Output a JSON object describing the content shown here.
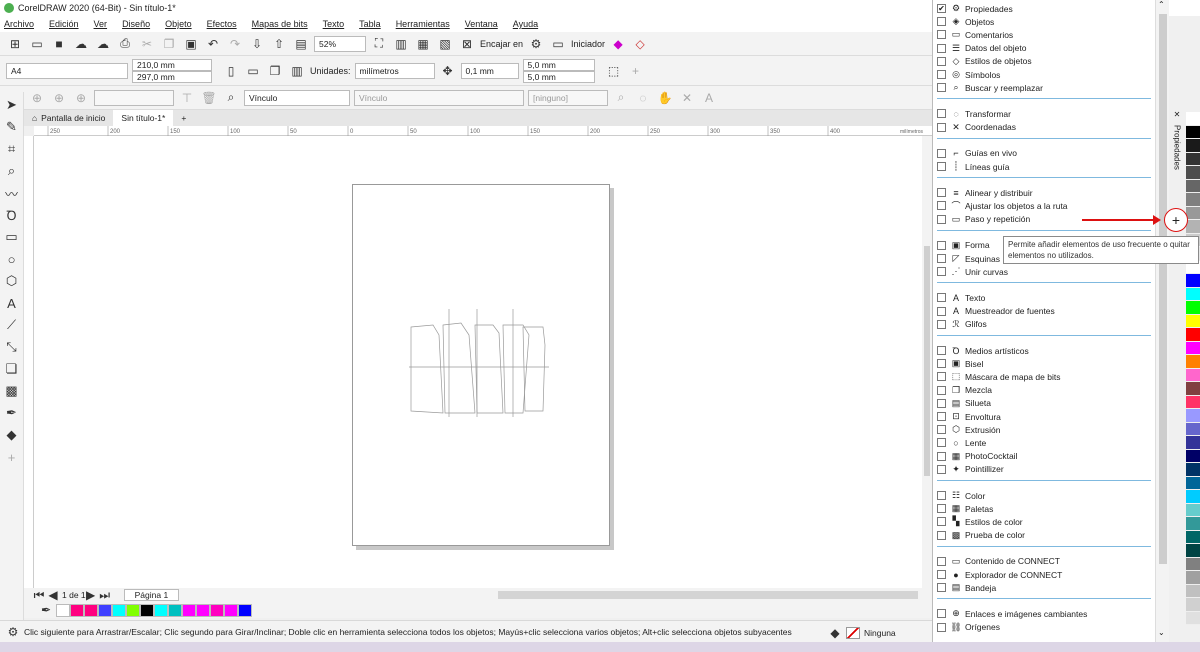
{
  "window": {
    "title": "CorelDRAW 2020 (64-Bit) - Sin título-1*"
  },
  "menu": [
    "Archivo",
    "Edición",
    "Ver",
    "Diseño",
    "Objeto",
    "Efectos",
    "Mapas de bits",
    "Texto",
    "Tabla",
    "Herramientas",
    "Ventana",
    "Ayuda"
  ],
  "toolbar1": {
    "zoom": "52%",
    "snap_label": "Encajar en",
    "launcher_label": "Iniciador"
  },
  "toolbar2": {
    "page_size": "A4",
    "width": "210,0 mm",
    "height": "297,0 mm",
    "units_label": "Unidades:",
    "units": "milímetros",
    "nudge": "0,1 mm",
    "dup_x": "5,0 mm",
    "dup_y": "5,0 mm"
  },
  "toolbar3": {
    "link1": "Vínculo",
    "link2": "Vínculo",
    "none": "[ninguno]"
  },
  "tabs": {
    "home": "Pantalla de inicio",
    "doc": "Sin título-1*"
  },
  "ruler": {
    "ticks": [
      "250",
      "200",
      "150",
      "100",
      "50",
      "0",
      "50",
      "100",
      "150",
      "200",
      "250",
      "300",
      "350",
      "400"
    ],
    "unit": "milímetros"
  },
  "pagebar": {
    "page_of": "1 de 1",
    "page_tab": "Página 1"
  },
  "status": {
    "hint": "Clic siguiente para Arrastrar/Escalar; Clic segundo para Girar/Inclinar; Doble clic en herramienta selecciona todos los objetos; Mayús+clic selecciona varios objetos; Alt+clic selecciona objetos subyacentes",
    "fill": "Ninguna"
  },
  "panel": {
    "side_tab": "Propiedades",
    "tooltip": "Permite añadir elementos de uso frecuente o quitar elementos no utilizados.",
    "groups": [
      {
        "items": [
          {
            "label": "Propiedades",
            "checked": true,
            "icon": "⚙"
          },
          {
            "label": "Objetos",
            "checked": false,
            "icon": "◈"
          },
          {
            "label": "Comentarios",
            "checked": false,
            "icon": "▭"
          },
          {
            "label": "Datos del objeto",
            "checked": false,
            "icon": "☰"
          },
          {
            "label": "Estilos de objetos",
            "checked": false,
            "icon": "◇"
          },
          {
            "label": "Símbolos",
            "checked": false,
            "icon": "◎"
          },
          {
            "label": "Buscar y reemplazar",
            "checked": false,
            "icon": "⌕"
          }
        ]
      },
      {
        "items": [
          {
            "label": "Transformar",
            "checked": false,
            "icon": "◌"
          },
          {
            "label": "Coordenadas",
            "checked": false,
            "icon": "✕"
          }
        ]
      },
      {
        "items": [
          {
            "label": "Guías en vivo",
            "checked": false,
            "icon": "⌐"
          },
          {
            "label": "Líneas guía",
            "checked": false,
            "icon": "┊"
          }
        ]
      },
      {
        "items": [
          {
            "label": "Alinear y distribuir",
            "checked": false,
            "icon": "≡"
          },
          {
            "label": "Ajustar los objetos a la ruta",
            "checked": false,
            "icon": "⌒"
          },
          {
            "label": "Paso y repetición",
            "checked": false,
            "icon": "▭"
          }
        ]
      },
      {
        "items": [
          {
            "label": "Forma",
            "checked": false,
            "icon": "▣"
          },
          {
            "label": "Esquinas",
            "checked": false,
            "icon": "◸"
          },
          {
            "label": "Unir curvas",
            "checked": false,
            "icon": "⋰"
          }
        ]
      },
      {
        "items": [
          {
            "label": "Texto",
            "checked": false,
            "icon": "A"
          },
          {
            "label": "Muestreador de fuentes",
            "checked": false,
            "icon": "A"
          },
          {
            "label": "Glifos",
            "checked": false,
            "icon": "ℛ"
          }
        ]
      },
      {
        "items": [
          {
            "label": "Medios artísticos",
            "checked": false,
            "icon": "Ꝺ"
          },
          {
            "label": "Bisel",
            "checked": false,
            "icon": "▣"
          },
          {
            "label": "Máscara de mapa de bits",
            "checked": false,
            "icon": "⬚"
          },
          {
            "label": "Mezcla",
            "checked": false,
            "icon": "❐"
          },
          {
            "label": "Silueta",
            "checked": false,
            "icon": "▤"
          },
          {
            "label": "Envoltura",
            "checked": false,
            "icon": "⊡"
          },
          {
            "label": "Extrusión",
            "checked": false,
            "icon": "⬡"
          },
          {
            "label": "Lente",
            "checked": false,
            "icon": "○"
          },
          {
            "label": "PhotoCocktail",
            "checked": false,
            "icon": "▦"
          },
          {
            "label": "Pointillizer",
            "checked": false,
            "icon": "✦"
          }
        ]
      },
      {
        "items": [
          {
            "label": "Color",
            "checked": false,
            "icon": "☷"
          },
          {
            "label": "Paletas",
            "checked": false,
            "icon": "▦"
          },
          {
            "label": "Estilos de color",
            "checked": false,
            "icon": "▚"
          },
          {
            "label": "Prueba de color",
            "checked": false,
            "icon": "▩"
          }
        ]
      },
      {
        "items": [
          {
            "label": "Contenido de CONNECT",
            "checked": false,
            "icon": "▭"
          },
          {
            "label": "Explorador de CONNECT",
            "checked": false,
            "icon": "●"
          },
          {
            "label": "Bandeja",
            "checked": false,
            "icon": "▤"
          }
        ]
      },
      {
        "items": [
          {
            "label": "Enlaces e imágenes cambiantes",
            "checked": false,
            "icon": "⊕"
          },
          {
            "label": "Orígenes",
            "checked": false,
            "icon": "⛓"
          }
        ]
      }
    ]
  },
  "doc_palette": [
    "#ff0080",
    "#ff0080",
    "#4040ff",
    "#00ffff",
    "#80ff00",
    "#000000",
    "#00ffff",
    "#00c0c0",
    "#ff00ff",
    "#ff00ff",
    "#ff00c0",
    "#ff00ff",
    "#0000ff"
  ],
  "right_palette": [
    "#ffffff",
    "#000000",
    "#1a1a1a",
    "#333333",
    "#4d4d4d",
    "#666666",
    "#808080",
    "#999999",
    "#b3b3b3",
    "#cccccc",
    "#e6e6e6",
    "#ffffff",
    "#0000ff",
    "#00ffff",
    "#00ff00",
    "#ffff00",
    "#ff0000",
    "#ff00ff",
    "#ff8000",
    "#ff66cc",
    "#804040",
    "#ff3366",
    "#9999ff",
    "#6666cc",
    "#333399",
    "#000066",
    "#003366",
    "#006699",
    "#00ccff",
    "#66cccc",
    "#339999",
    "#006666",
    "#004444",
    "#808080",
    "#a0a0a0",
    "#c0c0c0",
    "#d0d0d0",
    "#e0e0e0"
  ]
}
